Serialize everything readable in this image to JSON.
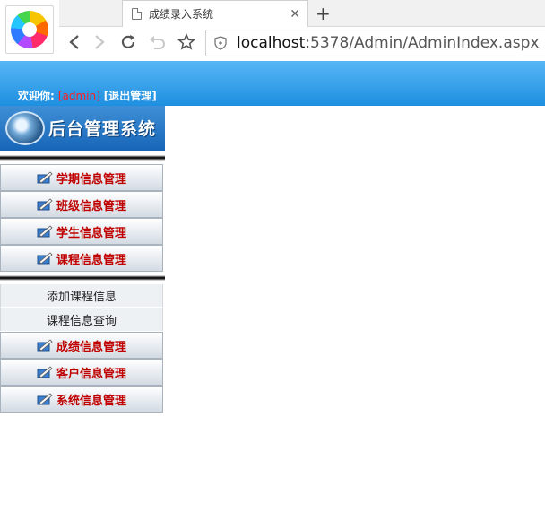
{
  "browser": {
    "tab_title": "成绩录入系统",
    "url_host": "localhost",
    "url_path": ":5378/Admin/AdminIndex.aspx"
  },
  "header": {
    "welcome_label": "欢迎你:",
    "username": "[admin]",
    "logout_label": "[退出管理]"
  },
  "sidebar": {
    "banner_title": "后台管理系统",
    "menus_top": [
      {
        "label": "学期信息管理"
      },
      {
        "label": "班级信息管理"
      },
      {
        "label": "学生信息管理"
      },
      {
        "label": "课程信息管理"
      }
    ],
    "subitems": [
      {
        "label": "添加课程信息"
      },
      {
        "label": "课程信息查询"
      }
    ],
    "menus_bottom": [
      {
        "label": "成绩信息管理"
      },
      {
        "label": "客户信息管理"
      },
      {
        "label": "系统信息管理"
      }
    ]
  },
  "colors": {
    "header_blue": "#1e8fe0",
    "menu_text": "#c00000",
    "username_red": "#ff2020"
  }
}
